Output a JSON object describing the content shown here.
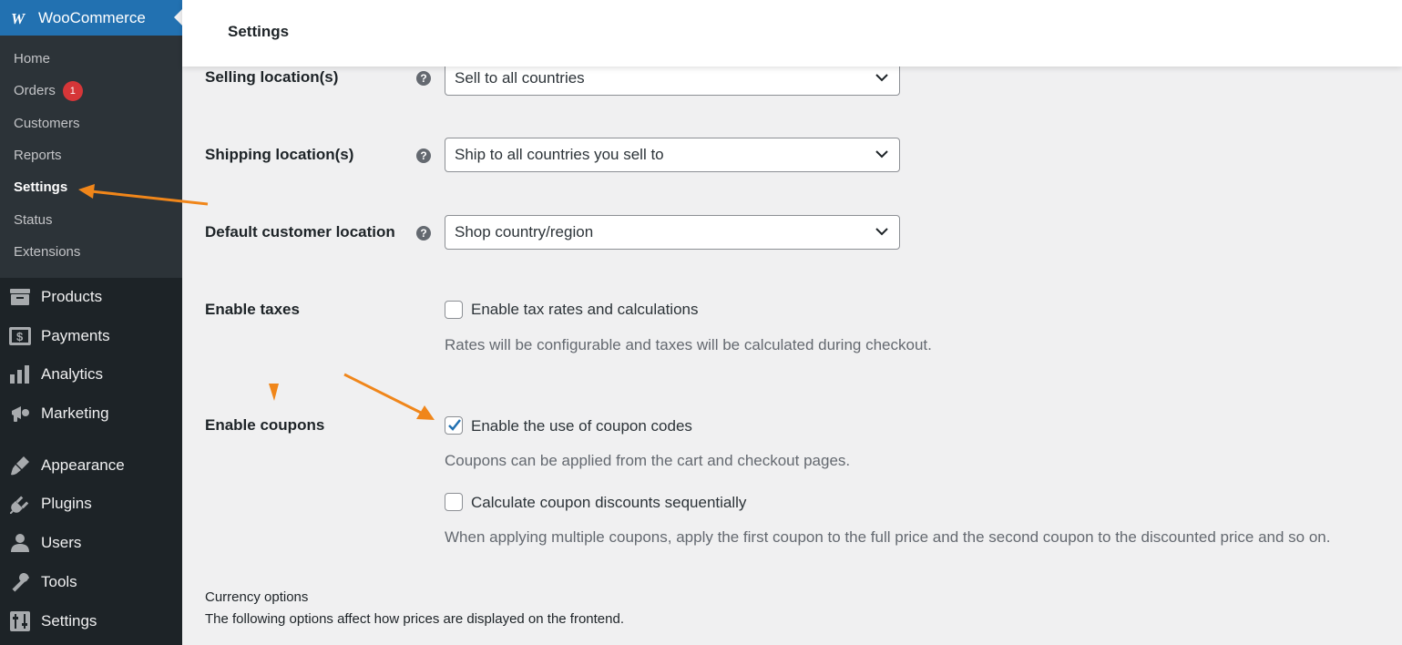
{
  "sidebar": {
    "brand": "WooCommerce",
    "submenu": [
      {
        "label": "Home"
      },
      {
        "label": "Orders",
        "badge": "1"
      },
      {
        "label": "Customers"
      },
      {
        "label": "Reports"
      },
      {
        "label": "Settings",
        "active": true
      },
      {
        "label": "Status"
      },
      {
        "label": "Extensions"
      }
    ],
    "menu": [
      {
        "label": "Products",
        "icon": "products-icon"
      },
      {
        "label": "Payments",
        "icon": "payments-icon"
      },
      {
        "label": "Analytics",
        "icon": "analytics-icon"
      },
      {
        "label": "Marketing",
        "icon": "marketing-icon"
      },
      {
        "label": "Appearance",
        "icon": "appearance-icon"
      },
      {
        "label": "Plugins",
        "icon": "plugins-icon"
      },
      {
        "label": "Users",
        "icon": "users-icon"
      },
      {
        "label": "Tools",
        "icon": "tools-icon"
      },
      {
        "label": "Settings",
        "icon": "settings-icon"
      }
    ]
  },
  "header": {
    "title": "Settings"
  },
  "form": {
    "selling_label": "Selling location(s)",
    "selling_value": "Sell to all countries",
    "shipping_label": "Shipping location(s)",
    "shipping_value": "Ship to all countries you sell to",
    "default_label": "Default customer location",
    "default_value": "Shop country/region",
    "help": "?",
    "taxes_label": "Enable taxes",
    "taxes_checkbox": "Enable tax rates and calculations",
    "taxes_checked": false,
    "taxes_desc": "Rates will be configurable and taxes will be calculated during checkout.",
    "coupons_label": "Enable coupons",
    "coupons_checkbox": "Enable the use of coupon codes",
    "coupons_checked": true,
    "coupons_desc": "Coupons can be applied from the cart and checkout pages.",
    "sequential_checkbox": "Calculate coupon discounts sequentially",
    "sequential_checked": false,
    "sequential_desc": "When applying multiple coupons, apply the first coupon to the full price and the second coupon to the discounted price and so on.",
    "currency_heading": "Currency options",
    "currency_desc": "The following options affect how prices are displayed on the frontend."
  },
  "colors": {
    "sidebar_bg": "#1d2327",
    "submenu_bg": "#2c3338",
    "brand_blue": "#2271b1",
    "badge_red": "#d63638",
    "checkbox_blue": "#2271b1",
    "annotation_orange": "#f0861a"
  }
}
